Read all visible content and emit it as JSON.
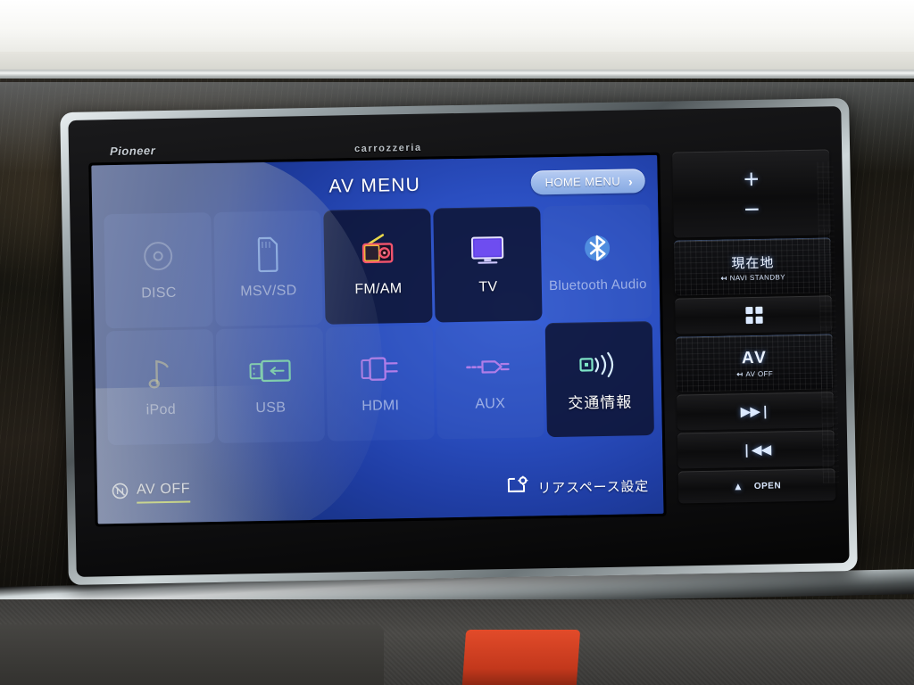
{
  "device": {
    "brand_left": "Pioneer",
    "brand_center": "carrozzeria"
  },
  "screen": {
    "title": "AV MENU",
    "home_menu": {
      "label": "HOME MENU",
      "chevron": "›",
      "icon": "chevron-right-icon"
    },
    "sources": [
      {
        "id": "disc",
        "label": "DISC",
        "icon": "disc-icon",
        "state": "disabled"
      },
      {
        "id": "msv-sd",
        "label": "MSV/SD",
        "icon": "sd-card-icon",
        "state": "disabled"
      },
      {
        "id": "fm-am",
        "label": "FM/AM",
        "icon": "radio-icon",
        "state": "enabled"
      },
      {
        "id": "tv",
        "label": "TV",
        "icon": "tv-icon",
        "state": "enabled"
      },
      {
        "id": "bt-audio",
        "label": "Bluetooth Audio",
        "icon": "bluetooth-icon",
        "state": "disabled"
      },
      {
        "id": "ipod",
        "label": "iPod",
        "icon": "music-note-icon",
        "state": "disabled"
      },
      {
        "id": "usb",
        "label": "USB",
        "icon": "usb-icon",
        "state": "disabled"
      },
      {
        "id": "hdmi",
        "label": "HDMI",
        "icon": "hdmi-icon",
        "state": "disabled"
      },
      {
        "id": "aux",
        "label": "AUX",
        "icon": "aux-jack-icon",
        "state": "disabled"
      },
      {
        "id": "traffic",
        "label": "交通情報",
        "icon": "broadcast-icon",
        "state": "enabled"
      }
    ],
    "av_off": {
      "label": "AV OFF",
      "icon": "av-off-icon",
      "underline_color": "#c8e04a"
    },
    "rear_space": {
      "label": "リアスペース設定",
      "icon": "screen-gear-icon"
    }
  },
  "hardkeys": [
    {
      "id": "volume",
      "icon": "volume-rocker",
      "plus": "＋",
      "minus": "－"
    },
    {
      "id": "current-location",
      "main": "現在地",
      "sub": "NAVI STANDBY",
      "sub_arrow": "↤"
    },
    {
      "id": "menu",
      "icon": "grid-menu-icon"
    },
    {
      "id": "av",
      "main": "AV",
      "sub": "AV OFF",
      "sub_arrow": "↤"
    },
    {
      "id": "next",
      "icon": "next-track-icon",
      "glyph": "▶▶❘"
    },
    {
      "id": "previous",
      "icon": "prev-track-icon",
      "glyph": "❘◀◀"
    },
    {
      "id": "eject",
      "icon": "eject-icon",
      "glyph": "▲",
      "label": "OPEN"
    }
  ],
  "colors": {
    "screen_bg": "#2a4ec0",
    "tile_enabled": "#0e1436",
    "accent_green": "#c8e04a",
    "home_menu_bg": "#9ebbeb",
    "bluetooth_blue": "#3a7fe0"
  }
}
